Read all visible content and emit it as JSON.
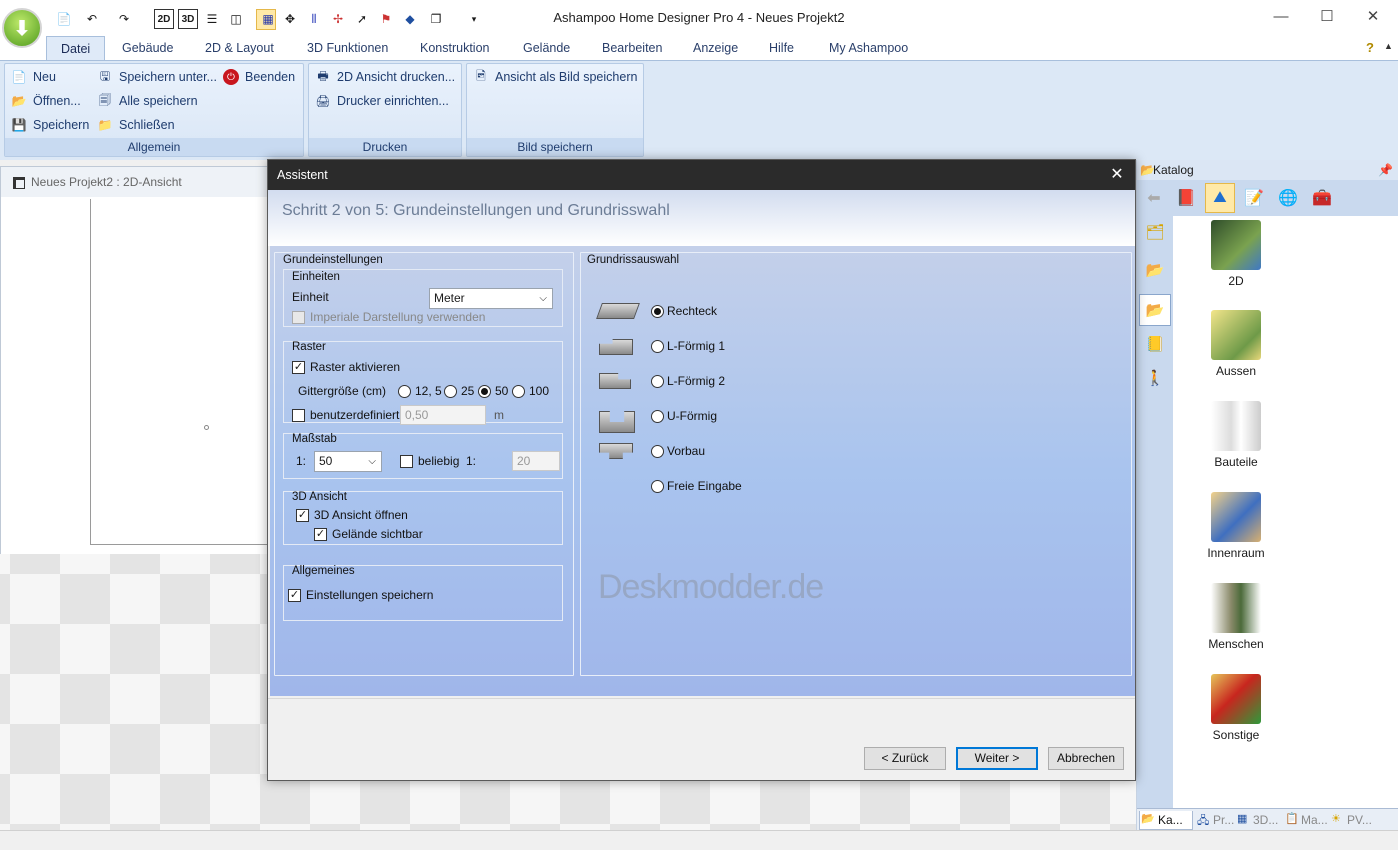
{
  "window": {
    "title": "Ashampoo Home Designer Pro 4 - Neues Projekt2",
    "minimize": "—",
    "maximize": "☐",
    "close": "✕"
  },
  "quick_access": {
    "view_2d": "2D",
    "view_3d": "3D"
  },
  "menu": [
    "Datei",
    "Gebäude",
    "2D & Layout",
    "3D Funktionen",
    "Konstruktion",
    "Gelände",
    "Bearbeiten",
    "Anzeige",
    "Hilfe",
    "My Ashampoo"
  ],
  "ribbon": {
    "allgemein": {
      "title": "Allgemein",
      "neu": "Neu",
      "oeffnen": "Öffnen...",
      "speichern": "Speichern",
      "speichern_unter": "Speichern unter...",
      "alle_speichern": "Alle speichern",
      "schliessen": "Schließen",
      "beenden": "Beenden"
    },
    "drucken": {
      "title": "Drucken",
      "ansicht_drucken": "2D Ansicht drucken...",
      "drucker": "Drucker einrichten..."
    },
    "bild": {
      "title": "Bild speichern",
      "ansicht_bild": "Ansicht als Bild speichern"
    }
  },
  "document": {
    "title": "Neues Projekt2 : 2D-Ansicht"
  },
  "catalog": {
    "title": "Katalog",
    "items": [
      "2D",
      "Aussen",
      "Bauteile",
      "Innenraum",
      "Menschen",
      "Sonstige"
    ],
    "bottom_tabs": [
      "Ka...",
      "Pr...",
      "3D...",
      "Ma...",
      "PV..."
    ]
  },
  "dialog": {
    "title": "Assistent",
    "heading": "Schritt 2 von 5:  Grundeinstellungen und Grundrisswahl",
    "grund": {
      "legend": "Grundeinstellungen",
      "einheiten": {
        "legend": "Einheiten",
        "label": "Einheit",
        "value": "Meter",
        "imperial": "Imperiale Darstellung verwenden"
      },
      "raster": {
        "legend": "Raster",
        "aktivieren": "Raster aktivieren",
        "gitter_label": "Gittergröße (cm)",
        "options": [
          "12, 5",
          "25",
          "50",
          "100"
        ],
        "selected": "50",
        "benutzer": "benutzerdefiniert",
        "benutzer_value": "0,50",
        "unit": "m"
      },
      "massstab": {
        "legend": "Maßstab",
        "prefix": "1:",
        "value": "50",
        "beliebig": "beliebig",
        "prefix2": "1:",
        "beliebig_value": "20"
      },
      "ansicht3d": {
        "legend": "3D Ansicht",
        "oeffnen": "3D Ansicht öffnen",
        "gelaende": "Gelände sichtbar"
      },
      "allgemeines": {
        "legend": "Allgemeines",
        "speichern": "Einstellungen speichern"
      }
    },
    "grundriss": {
      "legend": "Grundrissauswahl",
      "options": [
        "Rechteck",
        "L-Förmig 1",
        "L-Förmig 2",
        "U-Förmig",
        "Vorbau",
        "Freie Eingabe"
      ],
      "selected": "Rechteck"
    },
    "buttons": {
      "back": "< Zurück",
      "next": "Weiter >",
      "cancel": "Abbrechen"
    }
  },
  "watermark": "Deskmodder.de",
  "colors": {
    "accent": "#0078d7",
    "ribbon": "#dce8f6",
    "dialog_title": "#2b2b2b"
  }
}
